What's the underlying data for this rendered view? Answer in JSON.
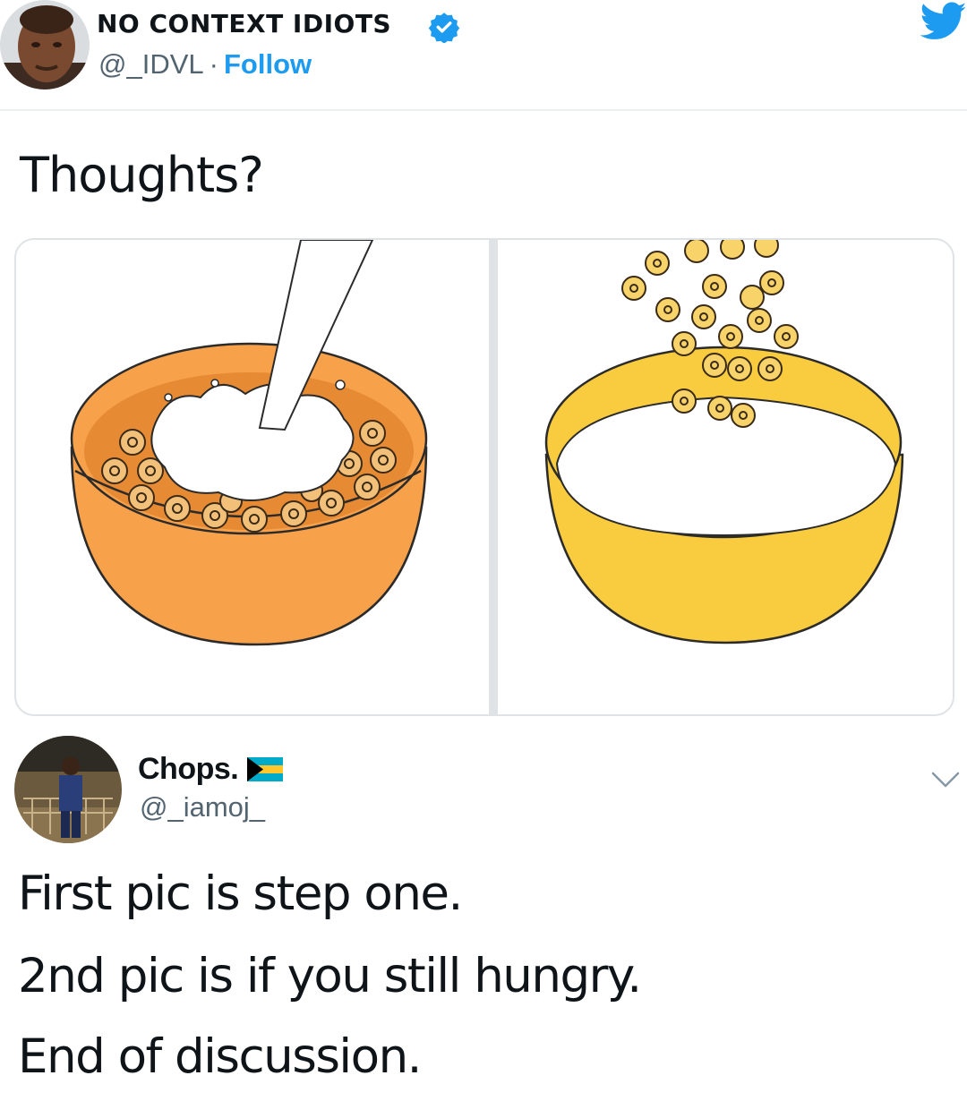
{
  "tweet": {
    "author_name": "NO CONTEXT IDIOTS",
    "author_handle": "@_IDVL",
    "separator": "·",
    "follow_label": "Follow",
    "text": "Thoughts?",
    "icons": {
      "verified": "verified-badge-icon",
      "logo": "twitter-bird-icon"
    },
    "colors": {
      "accent": "#1d9bf0",
      "secondary_text": "#536471"
    }
  },
  "media": {
    "panels": [
      {
        "description_icon": "orange-cereal-bowl",
        "bowl_color": "#f7a14a"
      },
      {
        "description_icon": "yellow-milk-bowl",
        "bowl_color": "#f9cb3e"
      }
    ]
  },
  "reply": {
    "author_name": "Chops.",
    "author_handle": "@_iamoj_",
    "flag_icon": "bahamas-flag-icon",
    "menu_icon": "chevron-down-icon",
    "lines": [
      "First pic is step one.",
      "2nd pic is if you still hungry.",
      "End of discussion."
    ]
  }
}
